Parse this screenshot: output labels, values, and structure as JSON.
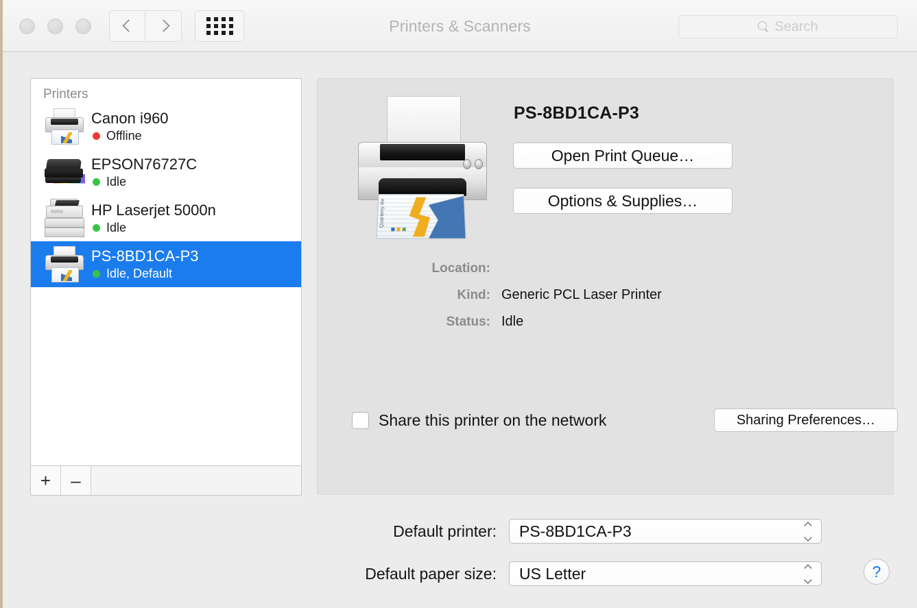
{
  "window": {
    "title": "Printers & Scanners",
    "traffic_lights": [
      "close",
      "minimize",
      "zoom"
    ]
  },
  "toolbar": {
    "back_icon": "chevron-left-icon",
    "forward_icon": "chevron-right-icon",
    "grid_icon": "show-all-grid-icon",
    "search": {
      "placeholder": "Search",
      "value": "",
      "icon": "search-icon"
    }
  },
  "printer_list": {
    "header": "Printers",
    "items": [
      {
        "name": "Canon i960",
        "status": "Offline",
        "status_color": "#f03a2e",
        "icon": "inkjet-printer-icon",
        "selected": false
      },
      {
        "name": "EPSON76727C",
        "status": "Idle",
        "status_color": "#36c646",
        "icon": "epson-printer-icon",
        "selected": false
      },
      {
        "name": "HP Laserjet 5000n",
        "status": "Idle",
        "status_color": "#36c646",
        "icon": "laser-printer-icon",
        "selected": false
      },
      {
        "name": "PS-8BD1CA-P3",
        "status": "Idle, Default",
        "status_color": "#36c646",
        "icon": "inkjet-printer-icon",
        "selected": true
      }
    ],
    "add_button": "+",
    "remove_button": "–",
    "selection_color": "#1b7cee"
  },
  "detail": {
    "printer_icon": "large-inkjet-printer-icon",
    "printer_sheet_label": "Quarterly Re",
    "title": "PS-8BD1CA-P3",
    "open_queue_button": "Open Print Queue…",
    "options_button": "Options & Supplies…",
    "fields": [
      {
        "label": "Location:",
        "value": ""
      },
      {
        "label": "Kind:",
        "value": "Generic PCL Laser Printer"
      },
      {
        "label": "Status:",
        "value": "Idle"
      }
    ],
    "share": {
      "checkbox_checked": false,
      "label": "Share this printer on the network",
      "button": "Sharing Preferences…"
    }
  },
  "bottom": {
    "default_printer": {
      "label": "Default printer:",
      "value": "PS-8BD1CA-P3"
    },
    "default_paper_size": {
      "label": "Default paper size:",
      "value": "US Letter"
    },
    "help_button": "?"
  }
}
